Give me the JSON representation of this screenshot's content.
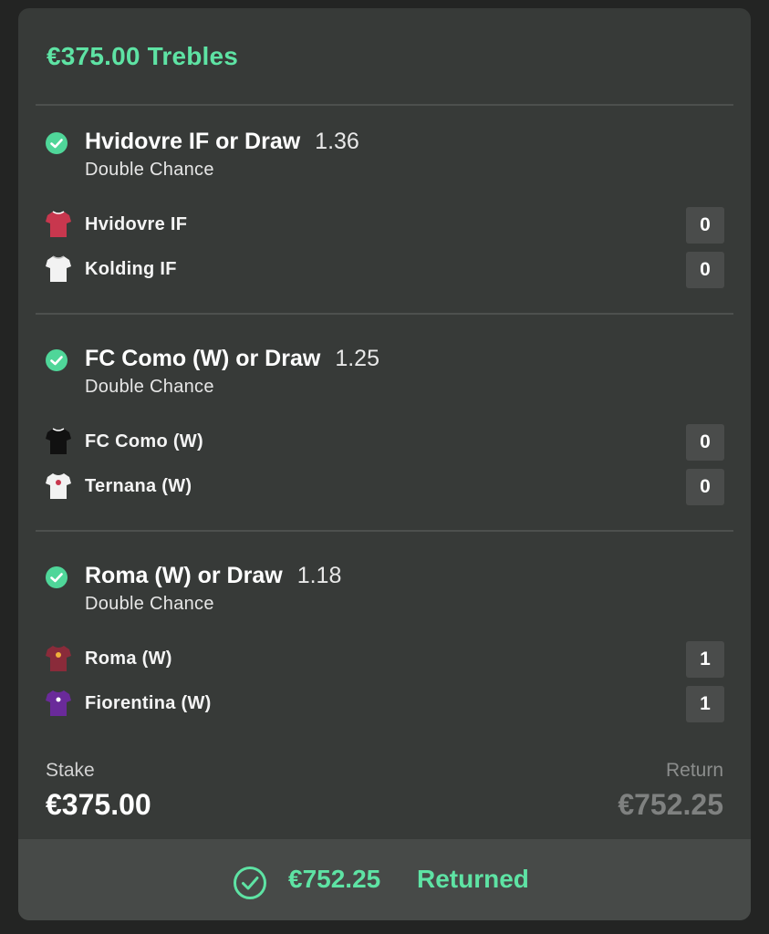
{
  "bet": {
    "title": "€375.00 Trebles",
    "stake_label": "Stake",
    "stake_value": "€375.00",
    "return_label": "Return",
    "return_value": "€752.25"
  },
  "selections": [
    {
      "title": "Hvidovre IF or Draw",
      "odds": "1.36",
      "market": "Double Chance",
      "teams": [
        {
          "name": "Hvidovre IF",
          "score": "0",
          "kit_color": "#c8374e",
          "kit_accent": "#ffffff",
          "icon": "shirt-icon"
        },
        {
          "name": "Kolding IF",
          "score": "0",
          "kit_color": "#f2f2f2",
          "kit_accent": "#cccccc",
          "icon": "shirt-icon"
        }
      ]
    },
    {
      "title": "FC Como (W) or Draw",
      "odds": "1.25",
      "market": "Double Chance",
      "teams": [
        {
          "name": "FC Como (W)",
          "score": "0",
          "kit_color": "#111111",
          "kit_accent": "#ffffff",
          "icon": "shirt-icon"
        },
        {
          "name": "Ternana (W)",
          "score": "0",
          "kit_color": "#f2f2f2",
          "kit_accent": "#c8374e",
          "icon": "shirt-icon"
        }
      ]
    },
    {
      "title": "Roma (W) or Draw",
      "odds": "1.18",
      "market": "Double Chance",
      "teams": [
        {
          "name": "Roma (W)",
          "score": "1",
          "kit_color": "#8a2b3a",
          "kit_accent": "#f0b03a",
          "icon": "shirt-icon"
        },
        {
          "name": "Fiorentina (W)",
          "score": "1",
          "kit_color": "#6a2a9a",
          "kit_accent": "#ffffff",
          "icon": "shirt-icon"
        }
      ]
    }
  ],
  "footer": {
    "amount": "€752.25",
    "status": "Returned",
    "icon": "check-circle-icon"
  },
  "colors": {
    "accent": "#5ee3a4",
    "check": "#4fd699",
    "card": "#373a38",
    "background": "#232423"
  }
}
